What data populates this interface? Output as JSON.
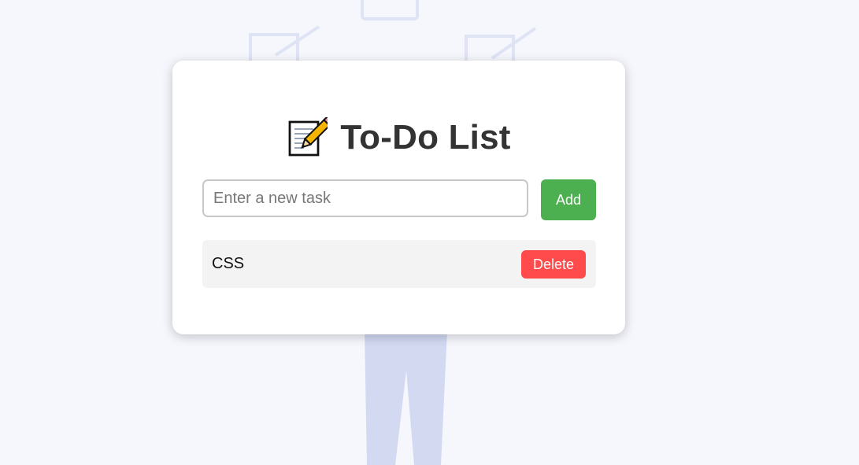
{
  "app": {
    "title": "To-Do List",
    "title_icon": "memo-icon"
  },
  "form": {
    "placeholder": "Enter a new task",
    "value": "",
    "add_label": "Add"
  },
  "tasks": [
    {
      "text": "CSS",
      "delete_label": "Delete"
    }
  ],
  "colors": {
    "add_button": "#4caf50",
    "delete_button": "#ff4b4b",
    "title": "#333333",
    "background": "#f6f7fd"
  }
}
